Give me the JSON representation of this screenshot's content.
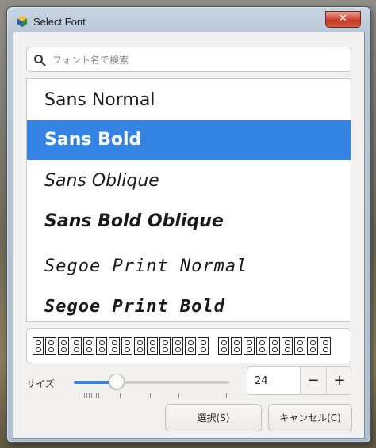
{
  "window": {
    "title": "Select Font",
    "close_label": "✕"
  },
  "search": {
    "placeholder": "フォント名で検索",
    "value": ""
  },
  "font_list": {
    "items": [
      {
        "label": "Sans Normal",
        "selected": false
      },
      {
        "label": "Sans Bold",
        "selected": true
      },
      {
        "label": "Sans Oblique",
        "selected": false
      },
      {
        "label": "Sans Bold Oblique",
        "selected": false
      },
      {
        "label": "Segoe Print Normal",
        "selected": false
      },
      {
        "label": "Segoe Print Bold",
        "selected": false
      }
    ]
  },
  "size": {
    "label": "サイズ",
    "value": "24",
    "decrement": "−",
    "increment": "+"
  },
  "buttons": {
    "select": "選択(S)",
    "cancel": "キャンセル(C)"
  },
  "colors": {
    "accent": "#3584e4",
    "close": "#c7452c"
  }
}
